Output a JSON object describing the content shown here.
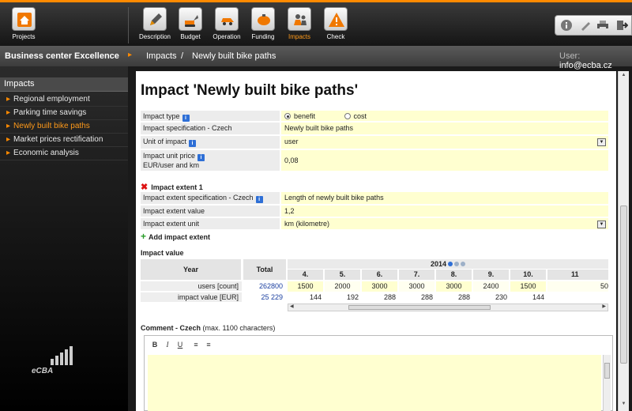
{
  "toolbar": {
    "projects": "Projects",
    "description": "Description",
    "budget": "Budget",
    "operation": "Operation",
    "funding": "Funding",
    "impacts": "Impacts",
    "check": "Check"
  },
  "breadcrumb": {
    "project": "Business center Excellence",
    "section": "Impacts",
    "separator": "/",
    "current": "Newly built bike paths",
    "user_label": "User:",
    "user_email": "info@ecba.cz"
  },
  "sidebar": {
    "title": "Impacts",
    "items": [
      {
        "label": "Regional employment"
      },
      {
        "label": "Parking time savings"
      },
      {
        "label": "Newly built bike paths"
      },
      {
        "label": "Market prices rectification"
      },
      {
        "label": "Economic analysis"
      }
    ],
    "logo": "eCBA"
  },
  "main": {
    "title": "Impact 'Newly built bike paths'",
    "impact_type_label": "Impact type",
    "impact_type_options": [
      "benefit",
      "cost"
    ],
    "impact_spec_label": "Impact specification - Czech",
    "impact_spec_value": "Newly built bike paths",
    "unit_label": "Unit of impact",
    "unit_value": "user",
    "price_label_line1": "Impact unit price",
    "price_label_line2": "EUR/user and km",
    "price_value": "0,08",
    "extent_title": "Impact extent 1",
    "extent_spec_label": "Impact extent specification - Czech",
    "extent_spec_value": "Length of newly built bike paths",
    "extent_value_label": "Impact extent value",
    "extent_value": "1,2",
    "extent_unit_label": "Impact extent unit",
    "extent_unit_value": "km (kilometre)",
    "add_extent": "Add impact extent",
    "impact_value_title": "Impact value",
    "comment_label": "Comment - Czech",
    "comment_hint": "(max. 1100 characters)"
  },
  "grid": {
    "year_header": "Year",
    "total_header": "Total",
    "year": "2014",
    "months": [
      "4.",
      "5.",
      "6.",
      "7.",
      "8.",
      "9.",
      "10.",
      "11"
    ],
    "rows": [
      {
        "label": "users [count]",
        "total": "262800",
        "values": [
          "1500",
          "2000",
          "3000",
          "3000",
          "3000",
          "2400",
          "1500",
          "50"
        ]
      },
      {
        "label": "impact value [EUR]",
        "total": "25 229",
        "values": [
          "144",
          "192",
          "288",
          "288",
          "288",
          "230",
          "144",
          ""
        ]
      }
    ]
  },
  "editor": {
    "bold": "B",
    "italic": "I",
    "underline": "U"
  },
  "colors": {
    "accent": "#ff8a00",
    "field_bg": "#ffffd0",
    "info_blue": "#2e6fd6"
  }
}
